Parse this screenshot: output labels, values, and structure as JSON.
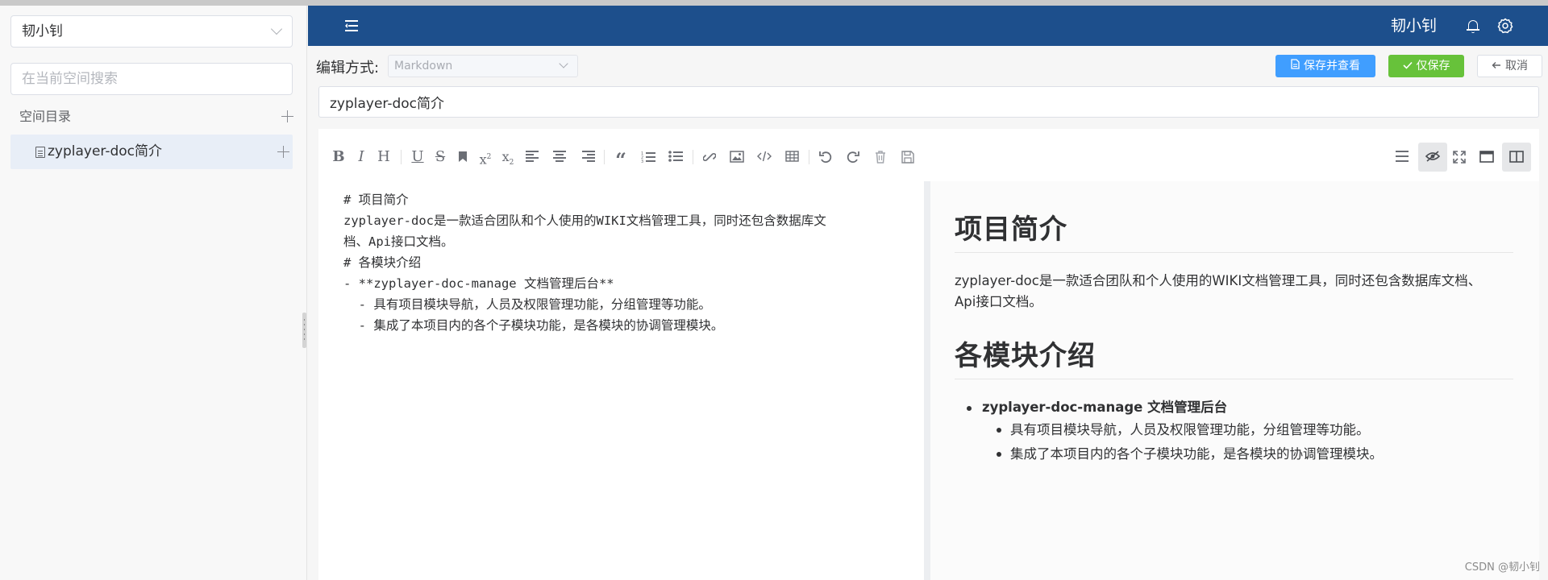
{
  "sidebar": {
    "space_select": "韧小钊",
    "search_placeholder": "在当前空间搜索",
    "directory_header": "空间目录",
    "tree_items": [
      {
        "label": "zyplayer-doc简介"
      }
    ]
  },
  "header": {
    "user_name": "韧小钊",
    "bg_color": "#1d4f8c"
  },
  "toolbar": {
    "edit_mode_label": "编辑方式:",
    "edit_mode_value": "Markdown",
    "save_view_label": "保存并查看",
    "save_only_label": "仅保存",
    "cancel_label": "取消"
  },
  "title_input": {
    "value": "zyplayer-doc简介"
  },
  "editor": {
    "toolbar_icons": [
      "bold-icon",
      "italic-icon",
      "heading-icon",
      "underline-icon",
      "strikethrough-icon",
      "bookmark-icon",
      "superscript-icon",
      "subscript-icon",
      "align-left-icon",
      "align-center-icon",
      "align-right-icon",
      "quote-icon",
      "ordered-list-icon",
      "unordered-list-icon",
      "link-icon",
      "image-icon",
      "code-icon",
      "table-icon",
      "undo-icon",
      "redo-icon",
      "trash-icon",
      "save-icon",
      "navigation-icon",
      "preview-toggle-icon",
      "fullscreen-icon",
      "read-mode-icon",
      "split-view-icon"
    ],
    "source_lines": [
      "# 项目简介",
      "zyplayer-doc是一款适合团队和个人使用的WIKI文档管理工具，同时还包含数据库文",
      "档、Api接口文档。",
      "# 各模块介绍",
      "- **zyplayer-doc-manage 文档管理后台**",
      "  - 具有项目模块导航，人员及权限管理功能，分组管理等功能。",
      "  - 集成了本项目内的各个子模块功能，是各模块的协调管理模块。"
    ],
    "preview": {
      "h1_a": "项目简介",
      "p_a_1": "zyplayer-doc是一款适合团队和个人使用的WIKI文档管理工具，同时还包含数据库文档、",
      "p_a_2": "Api接口文档。",
      "h1_b": "各模块介绍",
      "li_top": "zyplayer-doc-manage 文档管理后台",
      "li_sub_1": "具有项目模块导航，人员及权限管理功能，分组管理等功能。",
      "li_sub_2": "集成了本项目内的各个子模块功能，是各模块的协调管理模块。"
    }
  },
  "watermark": "CSDN @韧小钊"
}
